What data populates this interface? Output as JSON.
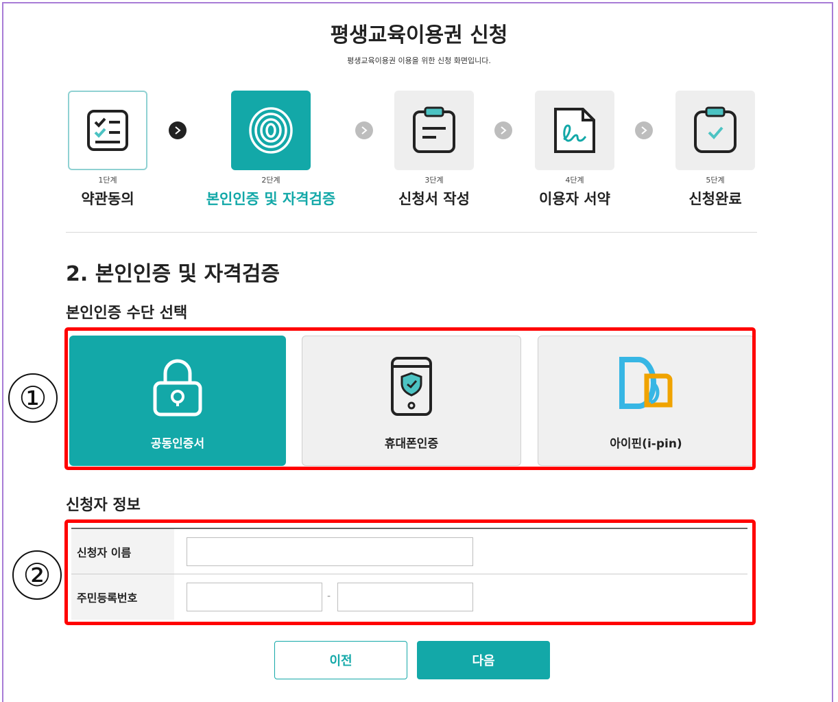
{
  "page": {
    "title": "평생교육이용권 신청",
    "subtitle": "평생교육이용권 이용을 위한 신청 화면입니다."
  },
  "steps": [
    {
      "num": "1단계",
      "label": "약관동의",
      "state": "done",
      "icon": "checklist-icon"
    },
    {
      "num": "2단계",
      "label": "본인인증 및 자격검증",
      "state": "active",
      "icon": "fingerprint-icon"
    },
    {
      "num": "3단계",
      "label": "신청서 작성",
      "state": "todo",
      "icon": "clipboard-icon"
    },
    {
      "num": "4단계",
      "label": "이용자 서약",
      "state": "todo",
      "icon": "signature-document-icon"
    },
    {
      "num": "5단계",
      "label": "신청완료",
      "state": "todo",
      "icon": "clipboard-check-icon"
    }
  ],
  "section": {
    "title": "2. 본인인증 및 자격검증",
    "auth_title": "본인인증 수단 선택",
    "applicant_title": "신청자 정보"
  },
  "auth_methods": [
    {
      "label": "공동인증서",
      "icon": "lock-icon",
      "selected": true
    },
    {
      "label": "휴대폰인증",
      "icon": "phone-shield-icon",
      "selected": false
    },
    {
      "label": "아이핀(i-pin)",
      "icon": "ipin-logo-icon",
      "selected": false
    }
  ],
  "annotations": {
    "one": "①",
    "two": "②"
  },
  "form": {
    "name_label": "신청자 이름",
    "name_value": "",
    "rrn_label": "주민등록번호",
    "rrn_front": "",
    "rrn_back": "",
    "rrn_separator": "-"
  },
  "buttons": {
    "prev": "이전",
    "next": "다음"
  },
  "colors": {
    "accent": "#13a8a8",
    "highlight": "#ff0000",
    "frame": "#a77bd6"
  }
}
